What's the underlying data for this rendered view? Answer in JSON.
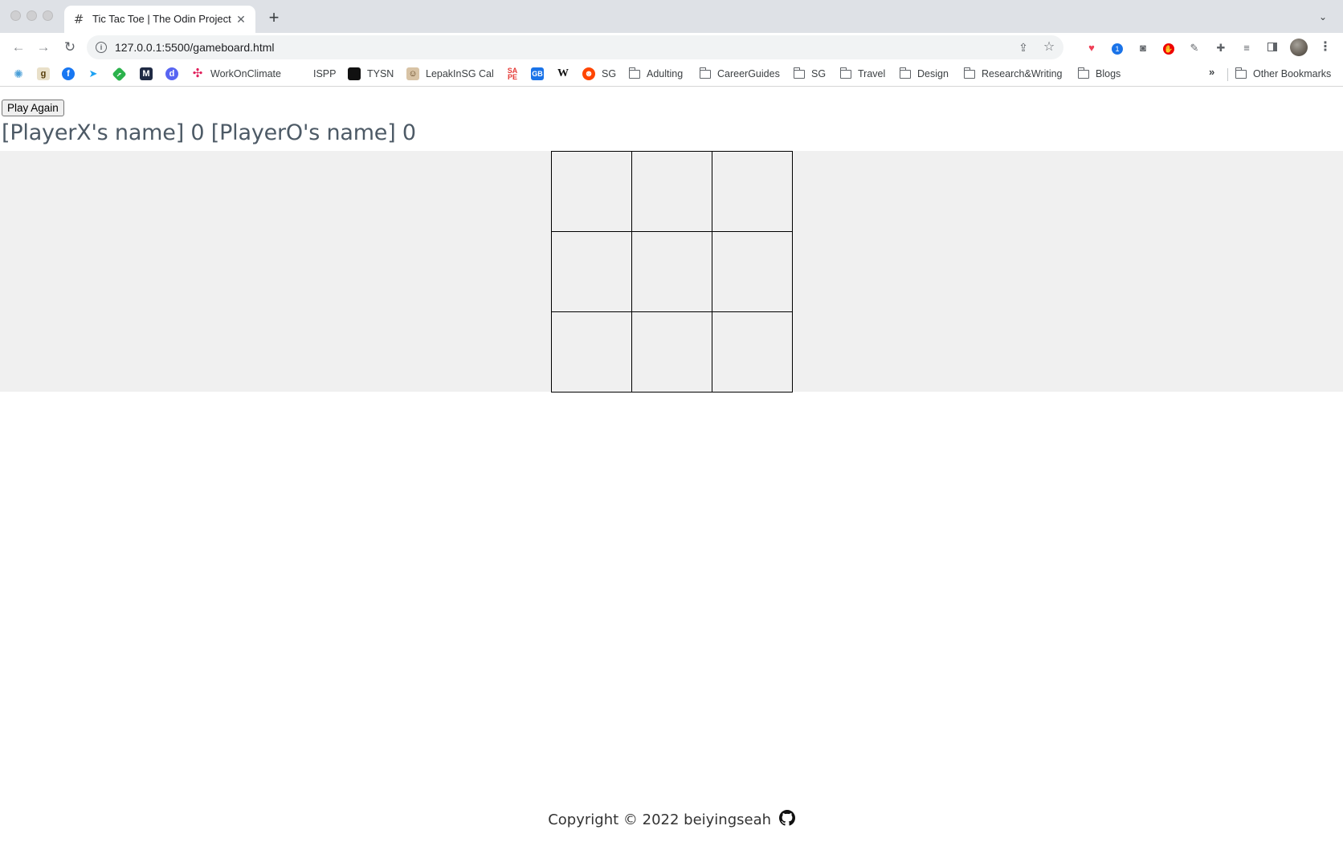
{
  "browser": {
    "tab": {
      "title": "Tic Tac Toe | The Odin Project",
      "favicon": "hash-grid-icon"
    },
    "address_bar": {
      "url": "127.0.0.1:5500/gameboard.html"
    },
    "bookmarks": [
      {
        "label": "",
        "icon": "codepen-icon",
        "color": "#4a9fd8"
      },
      {
        "label": "",
        "icon": "goodreads-icon",
        "color": "#c8b68c",
        "glyph": "g"
      },
      {
        "label": "",
        "icon": "facebook-icon",
        "color": "#1877f2",
        "glyph": "f"
      },
      {
        "label": "",
        "icon": "twitter-icon",
        "color": "#1da1f2",
        "glyph": "t"
      },
      {
        "label": "",
        "icon": "feedly-icon",
        "color": "#2bb24c",
        "glyph": "f"
      },
      {
        "label": "",
        "icon": "mail-icon",
        "color": "#1f2a44",
        "glyph": "M"
      },
      {
        "label": "",
        "icon": "discord-icon",
        "color": "#5865f2",
        "glyph": "d"
      },
      {
        "label": "WorkOnClimate",
        "icon": "slack-icon",
        "color": "#e01e5a"
      },
      {
        "label": "ISPP",
        "icon": "",
        "color": ""
      },
      {
        "label": "TYSN",
        "icon": "black-square-icon",
        "color": "#111111"
      },
      {
        "label": "LepakInSG Cal",
        "icon": "lepak-icon",
        "color": "#b38b59"
      },
      {
        "label": "",
        "icon": "sape-icon",
        "color": "#e53935",
        "glyph": "S"
      },
      {
        "label": "",
        "icon": "calendar-icon",
        "color": "#1a73e8",
        "glyph": "G"
      },
      {
        "label": "",
        "icon": "wikipedia-icon",
        "color": "#ffffff",
        "glyph": "W"
      },
      {
        "label": "SG",
        "icon": "reddit-icon",
        "color": "#ff4500"
      },
      {
        "label": "Adulting",
        "icon": "folder-icon",
        "color": ""
      },
      {
        "label": "CareerGuides",
        "icon": "folder-icon",
        "color": ""
      },
      {
        "label": "SG",
        "icon": "folder-icon",
        "color": ""
      },
      {
        "label": "Travel",
        "icon": "folder-icon",
        "color": ""
      },
      {
        "label": "Design",
        "icon": "folder-icon",
        "color": ""
      },
      {
        "label": "Research&Writing",
        "icon": "folder-icon",
        "color": ""
      },
      {
        "label": "Blogs",
        "icon": "folder-icon",
        "color": ""
      }
    ],
    "bookmarks_overflow": "»",
    "other_bookmarks": "Other Bookmarks"
  },
  "game": {
    "play_again_label": "Play Again",
    "scoreboard": {
      "text": "[PlayerX's name] 0 [PlayerO's name] 0",
      "player_x_name": "[PlayerX's name]",
      "player_x_score": 0,
      "player_o_name": "[PlayerO's name]",
      "player_o_score": 0
    },
    "board": [
      [
        "",
        "",
        ""
      ],
      [
        "",
        "",
        ""
      ],
      [
        "",
        "",
        ""
      ]
    ],
    "band_color": "#f0f0f0"
  },
  "footer": {
    "text": "Copyright © 2022 beiyingseah",
    "icon": "github-icon"
  }
}
